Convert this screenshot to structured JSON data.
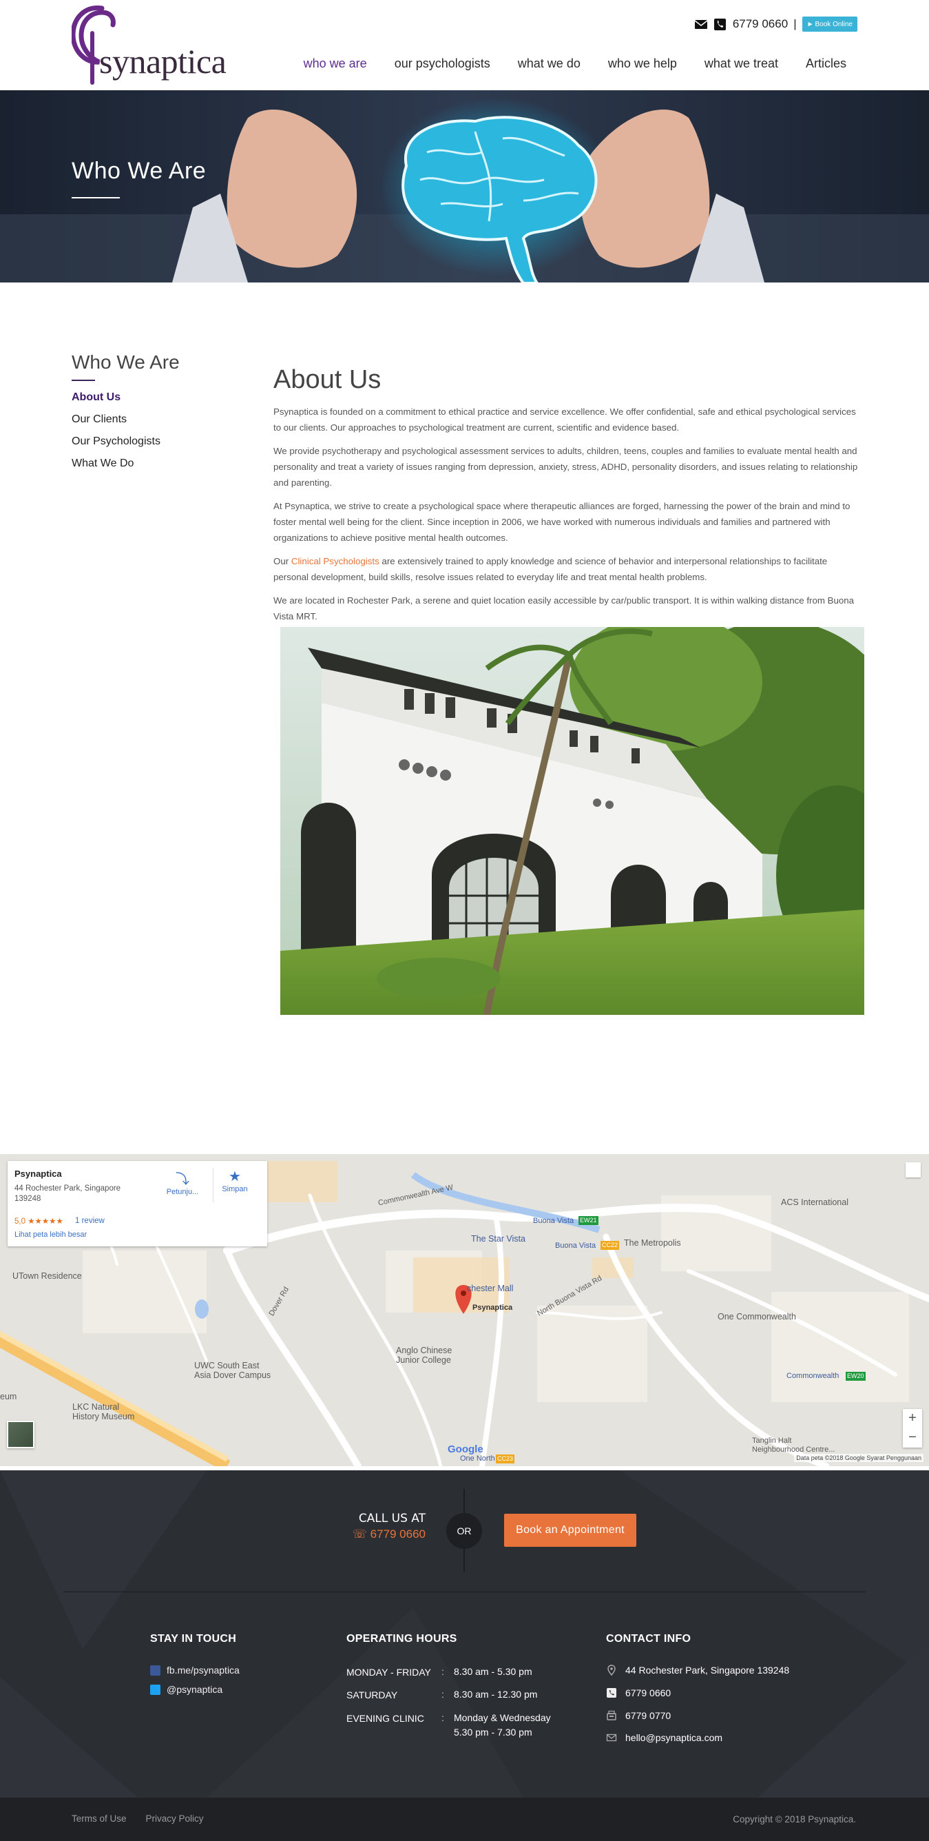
{
  "header": {
    "logo_text": "synaptica",
    "phone": "6779 0660",
    "separator": "|",
    "book_online": "Book Online",
    "nav": [
      {
        "label": "who we are",
        "active": true
      },
      {
        "label": "our psychologists",
        "active": false
      },
      {
        "label": "what we do",
        "active": false
      },
      {
        "label": "who we help",
        "active": false
      },
      {
        "label": "what we treat",
        "active": false
      },
      {
        "label": "Articles",
        "active": false
      }
    ]
  },
  "hero": {
    "title": "Who We Are"
  },
  "sidebar": {
    "title": "Who We Are",
    "items": [
      {
        "label": "About Us",
        "active": true
      },
      {
        "label": "Our Clients",
        "active": false
      },
      {
        "label": "Our Psychologists",
        "active": false
      },
      {
        "label": "What We Do",
        "active": false
      }
    ]
  },
  "main": {
    "title": "About Us",
    "p1": "Psynaptica is founded on a commitment to ethical practice and service excellence. We offer confidential, safe and ethical psychological services to our clients. Our approaches to psychological treatment are current, scientific and evidence based.",
    "p2": "We provide psychotherapy and psychological assessment services to adults, children, teens, couples and families to evaluate mental health and personality and treat a variety of issues  ranging from depression, anxiety, stress, ADHD, personality disorders, and issues relating to relationship and parenting.",
    "p3": "At Psynaptica, we strive to create a psychological space where therapeutic alliances are forged, harnessing the power of the brain and mind to foster mental well being for the client.  Since inception in 2006, we have worked with numerous individuals and families and partnered with organizations to achieve positive mental health outcomes.",
    "p4_before": "Our ",
    "p4_link": "Clinical Psychologists",
    "p4_after": " are extensively trained to apply knowledge and science of behavior and interpersonal relationships to facilitate personal development, build skills, resolve issues related to everyday life and treat mental health problems.",
    "p5": "We are located in Rochester Park, a serene and quiet location easily accessible by car/public transport. It is within walking distance from Buona Vista MRT."
  },
  "map": {
    "card": {
      "title": "Psynaptica",
      "address": "44 Rochester Park, Singapore 139248",
      "rating": "5,0",
      "stars": "★★★★★",
      "reviews": "1 review",
      "larger_map": "Lihat peta lebih besar",
      "directions": "Petunju...",
      "save": "Simpan"
    },
    "labels": {
      "utown": "UTown Residence",
      "nus_uwc": "UWC South East\nAsia Dover Campus",
      "lkc": "LKC Natural\nHistory Museum",
      "museum": "eum",
      "anglo": "Anglo Chinese\nJunior College",
      "star_vista": "The Star Vista",
      "rochester_mall": "chester Mall",
      "psynaptica": "Psynaptica",
      "buona_vista1": "Buona Vista",
      "buona_vista2": "Buona Vista",
      "metropolis": "The Metropolis",
      "one_commonwealth": "One Commonwealth",
      "acs": "ACS International",
      "commonwealth": "Commonwealth",
      "tanglin_halt": "Tanglin Halt\nNeighbourhood Centre...",
      "one_north": "One North",
      "ew21": "EW21",
      "cc22": "CC22",
      "ew20": "EW20",
      "cc23": "CC23",
      "commonwealth_ave_w": "Commonwealth Ave W",
      "north_buona_vista": "North Buona Vista Rd",
      "dover_rd": "Dover Rd",
      "google": "Google",
      "attribution": "Data peta ©2018 Google   Syarat Penggunaan"
    },
    "zoom_in": "+",
    "zoom_out": "−"
  },
  "footer": {
    "call_label": "CALL US AT",
    "call_number": "6779 0660",
    "or": "OR",
    "book_button": "Book an Appointment",
    "stay_title": "STAY IN TOUCH",
    "facebook": "fb.me/psynaptica",
    "twitter": "@psynaptica",
    "hours_title": "OPERATING HOURS",
    "hours": [
      {
        "day": "MONDAY - FRIDAY",
        "time": "8.30 am - 5.30 pm"
      },
      {
        "day": "SATURDAY",
        "time": "8.30 am - 12.30 pm"
      },
      {
        "day": "EVENING CLINIC",
        "time": "Monday & Wednesday",
        "time2": "5.30 pm - 7.30 pm"
      }
    ],
    "colon": ":",
    "contact_title": "CONTACT INFO",
    "address": "44 Rochester Park, Singapore 139248",
    "phone": "6779 0660",
    "fax": "6779 0770",
    "email": "hello@psynaptica.com",
    "terms": "Terms of Use",
    "privacy": "Privacy Policy",
    "copyright": "Copyright © 2018 Psynaptica."
  },
  "colors": {
    "brand_purple": "#5b2d8e",
    "accent_orange": "#e8743b",
    "book_online_blue": "#3bb3d6",
    "footer_bg": "#2b2e33"
  },
  "icons": [
    "envelope-icon",
    "phone-icon",
    "chevron-right-icon",
    "brain-image",
    "map-pin-icon",
    "directions-icon",
    "star-icon",
    "facebook-icon",
    "twitter-icon",
    "location-icon",
    "phone-square-icon",
    "fax-icon",
    "mail-icon"
  ]
}
